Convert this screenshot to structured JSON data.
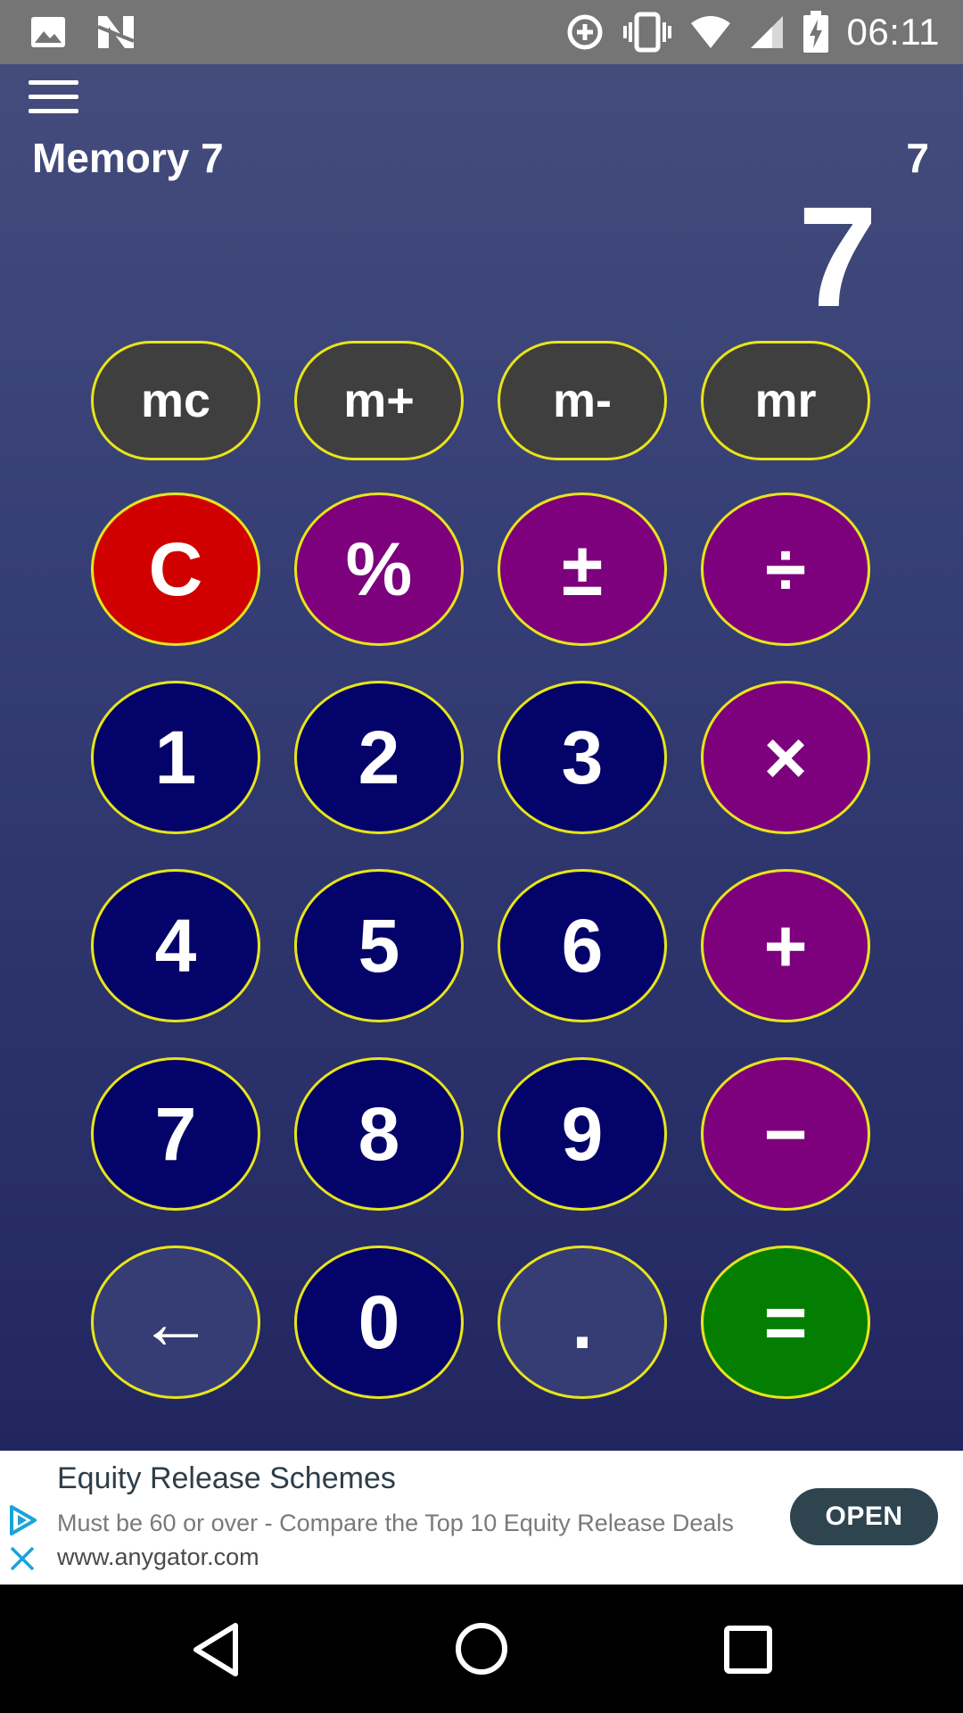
{
  "status_bar": {
    "time": "06:11",
    "left_icons": [
      "image-icon",
      "n-notification-icon"
    ],
    "right_icons": [
      "data-saver-icon",
      "vibrate-icon",
      "wifi-icon",
      "signal-icon",
      "battery-charging-icon"
    ]
  },
  "display": {
    "memory_label": "Memory 7",
    "expression": "7",
    "result": "7"
  },
  "memory_keys": [
    {
      "label": "mc"
    },
    {
      "label": "m+"
    },
    {
      "label": "m-"
    },
    {
      "label": "mr"
    }
  ],
  "keys": {
    "clear": "C",
    "percent": "%",
    "plus_minus": "±",
    "divide": "÷",
    "one": "1",
    "two": "2",
    "three": "3",
    "multiply": "×",
    "four": "4",
    "five": "5",
    "six": "6",
    "plus": "+",
    "seven": "7",
    "eight": "8",
    "nine": "9",
    "minus": "−",
    "backspace": "←",
    "zero": "0",
    "decimal": ".",
    "equals": "="
  },
  "colors": {
    "key_border": "#e8e41a",
    "memory_key": "#3f3f3f",
    "clear_key": "#d10000",
    "operator_key": "#7d017d",
    "number_key": "#03036a",
    "equals_key": "#037e03",
    "background_top": "#444c7c",
    "background_bottom": "#222660"
  },
  "ad": {
    "title": "Equity Release Schemes",
    "body": "Must be 60 or over - Compare the Top 10 Equity Release Deals",
    "url": "www.anygator.com",
    "button_label": "OPEN"
  },
  "nav_bar": {
    "icons": [
      "back-icon",
      "home-icon",
      "recents-icon"
    ]
  }
}
